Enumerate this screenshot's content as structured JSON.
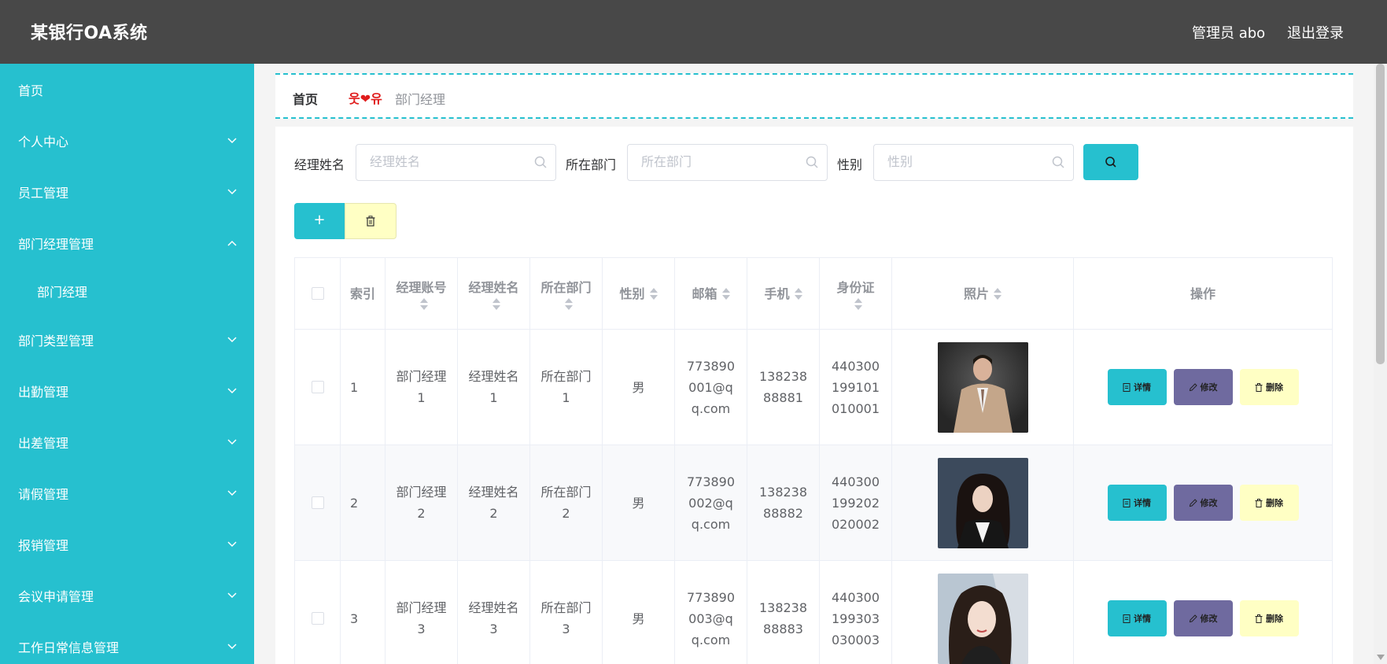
{
  "header": {
    "title": "某银行OA系统",
    "user": "管理员 abo",
    "logout": "退出登录"
  },
  "sidebar": {
    "items": [
      {
        "label": "首页"
      },
      {
        "label": "个人中心"
      },
      {
        "label": "员工管理"
      },
      {
        "label": "部门经理管理"
      },
      {
        "label": "部门经理"
      },
      {
        "label": "部门类型管理"
      },
      {
        "label": "出勤管理"
      },
      {
        "label": "出差管理"
      },
      {
        "label": "请假管理"
      },
      {
        "label": "报销管理"
      },
      {
        "label": "会议申请管理"
      },
      {
        "label": "工作日常信息管理"
      }
    ]
  },
  "breadcrumb": {
    "home": "首页",
    "separator": "웃❤유",
    "current": "部门经理"
  },
  "search": {
    "name_label": "经理姓名",
    "name_placeholder": "经理姓名",
    "dept_label": "所在部门",
    "dept_placeholder": "所在部门",
    "gender_label": "性别",
    "gender_placeholder": "性别"
  },
  "toolbar": {
    "add_label": "+"
  },
  "table": {
    "headers": {
      "index": "索引",
      "account": "经理账号",
      "name": "经理姓名",
      "dept": "所在部门",
      "gender": "性别",
      "email": "邮箱",
      "phone": "手机",
      "idcard": "身份证",
      "photo": "照片",
      "ops": "操作"
    },
    "rows": [
      {
        "index": "1",
        "account": "部门经理1",
        "name": "经理姓名1",
        "dept": "所在部门1",
        "gender": "男",
        "email": "773890001@qq.com",
        "phone": "13823888881",
        "idcard": "440300199101010001"
      },
      {
        "index": "2",
        "account": "部门经理2",
        "name": "经理姓名2",
        "dept": "所在部门2",
        "gender": "男",
        "email": "773890002@qq.com",
        "phone": "13823888882",
        "idcard": "440300199202020002"
      },
      {
        "index": "3",
        "account": "部门经理3",
        "name": "经理姓名3",
        "dept": "所在部门3",
        "gender": "男",
        "email": "773890003@qq.com",
        "phone": "13823888883",
        "idcard": "440300199303030003"
      }
    ],
    "actions": {
      "detail": "详情",
      "edit": "修改",
      "delete": "删除"
    }
  },
  "colors": {
    "accent": "#26c0cf",
    "header_bg": "#484848",
    "edit": "#6f6a9f",
    "delete": "#ffffc4"
  },
  "icons": {
    "search": "search-icon",
    "delete": "trash-icon",
    "detail": "document-icon",
    "edit": "pencil-icon"
  }
}
